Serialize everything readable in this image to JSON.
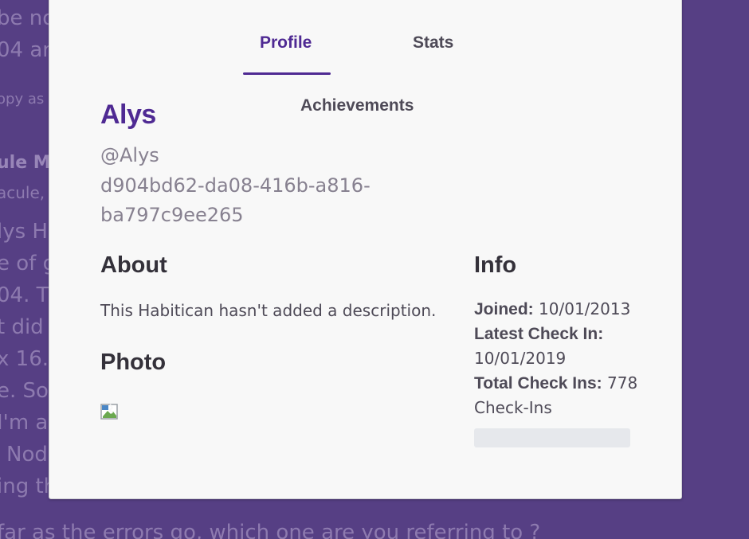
{
  "background": {
    "lines": [
      "be no",
      "04 an",
      "opy as",
      "ule M",
      "acule,",
      "lys H",
      "e of g",
      "04. Th",
      "t did",
      "x 16.",
      "e. So",
      "I'm a",
      "Nod",
      "ing th",
      "far as the errors go, which one are you referring to ?"
    ]
  },
  "tabs": {
    "profile": "Profile",
    "stats": "Stats",
    "achievements": "Achievements"
  },
  "profile": {
    "name": "Alys",
    "handle": "@Alys",
    "uuid": "d904bd62-da08-416b-a816-ba797c9ee265"
  },
  "about": {
    "title": "About",
    "text": "This Habitican hasn't added a description."
  },
  "photo": {
    "title": "Photo"
  },
  "info": {
    "title": "Info",
    "joined_label": "Joined:",
    "joined_value": "10/01/2013",
    "latest_label": "Latest Check In:",
    "latest_value": "10/01/2019",
    "total_label": "Total Check Ins:",
    "total_value": "778 Check-Ins"
  },
  "colors": {
    "backdrop": "#563f84",
    "accent": "#4f2a93",
    "modal_bg": "#f8f8f8"
  }
}
